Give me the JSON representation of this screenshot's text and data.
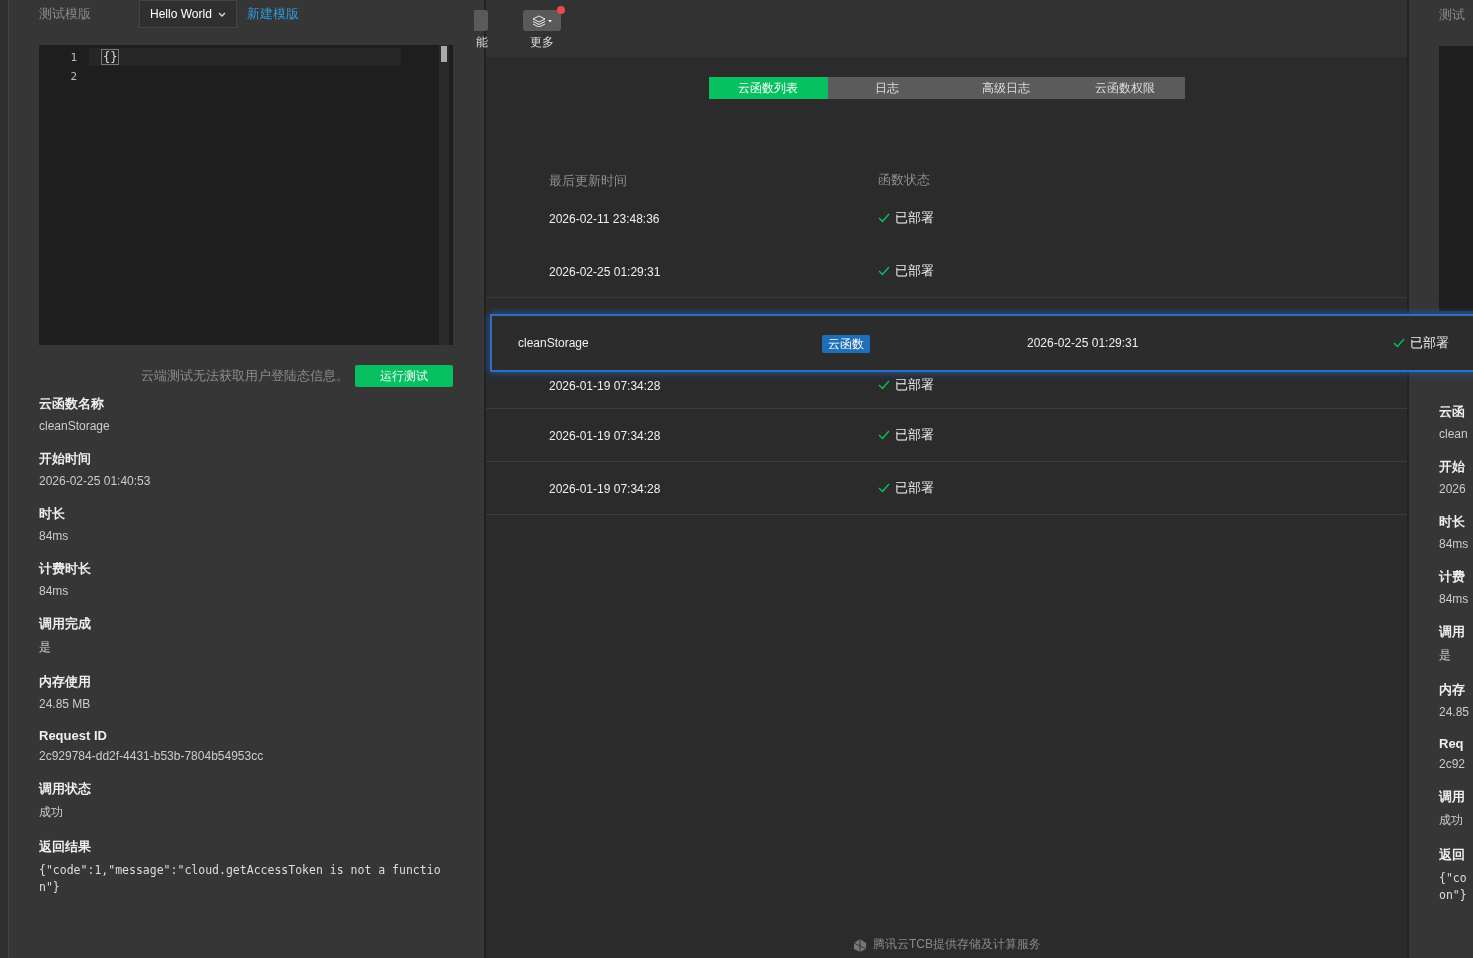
{
  "left_panel": {
    "title": "测试模版",
    "template_select": "Hello World",
    "new_template_link": "新建模版",
    "editor": {
      "line_numbers": [
        "1",
        "2"
      ],
      "code": "{}"
    },
    "hint": "云端测试无法获取用户登陆态信息。",
    "run_button": "运行测试",
    "fields": [
      {
        "label": "云函数名称",
        "value": "cleanStorage",
        "kind": "text"
      },
      {
        "label": "开始时间",
        "value": "2026-02-25 01:40:53",
        "kind": "text"
      },
      {
        "label": "时长",
        "value": "84ms",
        "kind": "text"
      },
      {
        "label": "计费时长",
        "value": "84ms",
        "kind": "text"
      },
      {
        "label": "调用完成",
        "value": "是",
        "kind": "text"
      },
      {
        "label": "内存使用",
        "value": "24.85 MB",
        "kind": "text"
      },
      {
        "label": "Request ID",
        "value": "2c929784-dd2f-4431-b53b-7804b54953cc",
        "kind": "text"
      },
      {
        "label": "调用状态",
        "value": "成功",
        "kind": "text"
      },
      {
        "label": "返回结果",
        "value": "{\"code\":1,\"message\":\"cloud.getAccessToken is not a function\"}",
        "kind": "code"
      }
    ]
  },
  "toolbar": [
    {
      "label": "能",
      "notification": false
    },
    {
      "label": "更多",
      "notification": true
    }
  ],
  "tabs": [
    {
      "label": "云函数列表",
      "selected": true
    },
    {
      "label": "日志",
      "selected": false
    },
    {
      "label": "高级日志",
      "selected": false
    },
    {
      "label": "云函数权限",
      "selected": false
    }
  ],
  "table": {
    "columns": [
      "最后更新时间",
      "函数状态"
    ],
    "rows": [
      {
        "updated": "2026-02-11 23:48:36",
        "status": "已部署"
      },
      {
        "updated": "2026-02-25 01:29:31",
        "status": "已部署"
      },
      {
        "updated": "2026-01-19 07:34:28",
        "status": "已部署"
      },
      {
        "updated": "2026-01-19 07:34:28",
        "status": "已部署"
      },
      {
        "updated": "2026-01-19 07:34:28",
        "status": "已部署"
      }
    ]
  },
  "dragged_row": {
    "name": "cleanStorage",
    "tag": "云函数",
    "updated": "2026-02-25 01:29:31",
    "status": "已部署"
  },
  "footer": "腾讯云TCB提供存储及计算服务",
  "right_panel": {
    "title": "测试",
    "fields": [
      {
        "label": "云函",
        "value": "clean"
      },
      {
        "label": "开始",
        "value": "2026"
      },
      {
        "label": "时长",
        "value": "84ms"
      },
      {
        "label": "计费",
        "value": "84ms"
      },
      {
        "label": "调用",
        "value": "是"
      },
      {
        "label": "内存",
        "value": "24.85"
      },
      {
        "label": "Req",
        "value": "2c92"
      },
      {
        "label": "调用",
        "value": "成功"
      },
      {
        "label": "返回",
        "value": "{\"co"
      }
    ],
    "result_tail": "on\"}"
  }
}
